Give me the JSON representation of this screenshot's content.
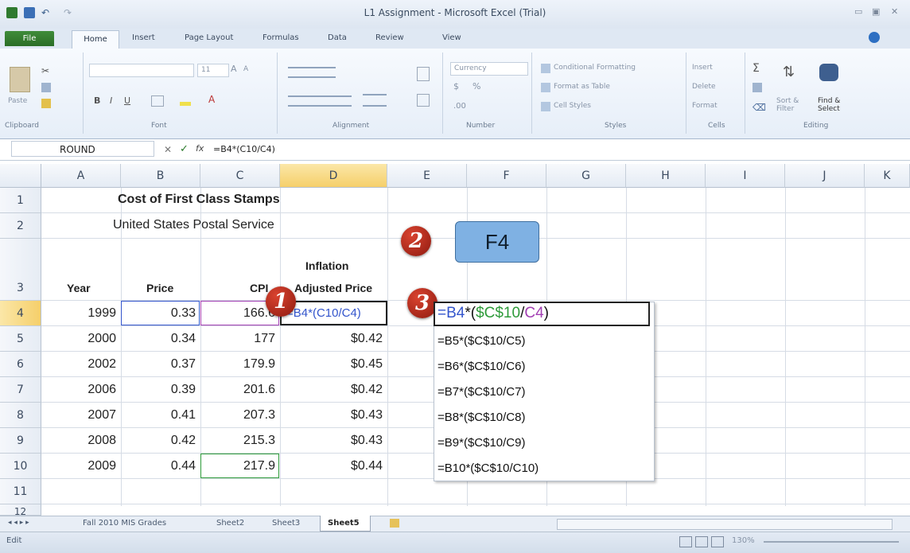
{
  "window": {
    "title": "L1 Assignment - Microsoft Excel (Trial)"
  },
  "ribbon": {
    "tabs": {
      "file": "File",
      "home": "Home",
      "insert": "Insert",
      "page_layout": "Page Layout",
      "formulas": "Formulas",
      "data": "Data",
      "review": "Review",
      "view": "View"
    },
    "groups": {
      "clipboard": "Clipboard",
      "font": "Font",
      "alignment": "Alignment",
      "number": "Number",
      "styles": "Styles",
      "cells": "Cells",
      "editing": "Editing"
    },
    "clipboard": {
      "paste": "Paste"
    },
    "font": {
      "size": "11",
      "bold": "B",
      "italic": "I",
      "underline": "U"
    },
    "number": {
      "format": "Currency",
      "dollar": "$",
      "percent": "%"
    },
    "styles": {
      "conditional": "Conditional Formatting",
      "table": "Format as Table",
      "cell_styles": "Cell Styles"
    },
    "cells": {
      "insert": "Insert",
      "delete": "Delete",
      "format": "Format"
    },
    "editing": {
      "sort": "Sort & Filter",
      "find": "Find & Select"
    }
  },
  "formula_bar": {
    "name_box": "ROUND",
    "fx": "fx",
    "formula": "=B4*(C10/C4)"
  },
  "columns": [
    "A",
    "B",
    "C",
    "D",
    "E",
    "F",
    "G",
    "H",
    "I",
    "J",
    "K"
  ],
  "rows": [
    "1",
    "2",
    "3",
    "4",
    "5",
    "6",
    "7",
    "8",
    "9",
    "10",
    "11",
    "12"
  ],
  "sheet": {
    "title": "Cost of First Class Stamps",
    "subtitle": "United States Postal Service",
    "headers": {
      "year": "Year",
      "price": "Price",
      "cpi": "CPI",
      "inflation_1": "Inflation",
      "inflation_2": "Adjusted Price"
    },
    "data": [
      {
        "year": "1999",
        "price": "0.33",
        "cpi": "166.6",
        "adjusted": "=B4*(C10/C4)"
      },
      {
        "year": "2000",
        "price": "0.34",
        "cpi": "177",
        "adjusted": "$0.42"
      },
      {
        "year": "2002",
        "price": "0.37",
        "cpi": "179.9",
        "adjusted": "$0.45"
      },
      {
        "year": "2006",
        "price": "0.39",
        "cpi": "201.6",
        "adjusted": "$0.42"
      },
      {
        "year": "2007",
        "price": "0.41",
        "cpi": "207.3",
        "adjusted": "$0.43"
      },
      {
        "year": "2008",
        "price": "0.42",
        "cpi": "215.3",
        "adjusted": "$0.43"
      },
      {
        "year": "2009",
        "price": "0.44",
        "cpi": "217.9",
        "adjusted": "$0.44"
      }
    ]
  },
  "callouts": {
    "one": "1",
    "two": "2",
    "three": "3",
    "f4_key": "F4"
  },
  "formula_list": [
    "=B4*($C$10/C4)",
    "=B5*($C$10/C5)",
    "=B6*($C$10/C6)",
    "=B7*($C$10/C7)",
    "=B8*($C$10/C8)",
    "=B9*($C$10/C9)",
    "=B10*($C$10/C10)"
  ],
  "sheet_tabs": [
    "Fall 2010 MIS Grades",
    "Sheet2",
    "Sheet3",
    "Sheet5"
  ],
  "status": {
    "mode": "Edit",
    "zoom": "130%"
  },
  "colors": {
    "ref_blue": "#3355cc",
    "ref_green": "#2e9b3a",
    "ref_purple": "#a23fb3",
    "badge_red": "#b52a1c",
    "f4_blue": "#7fb1e3"
  }
}
